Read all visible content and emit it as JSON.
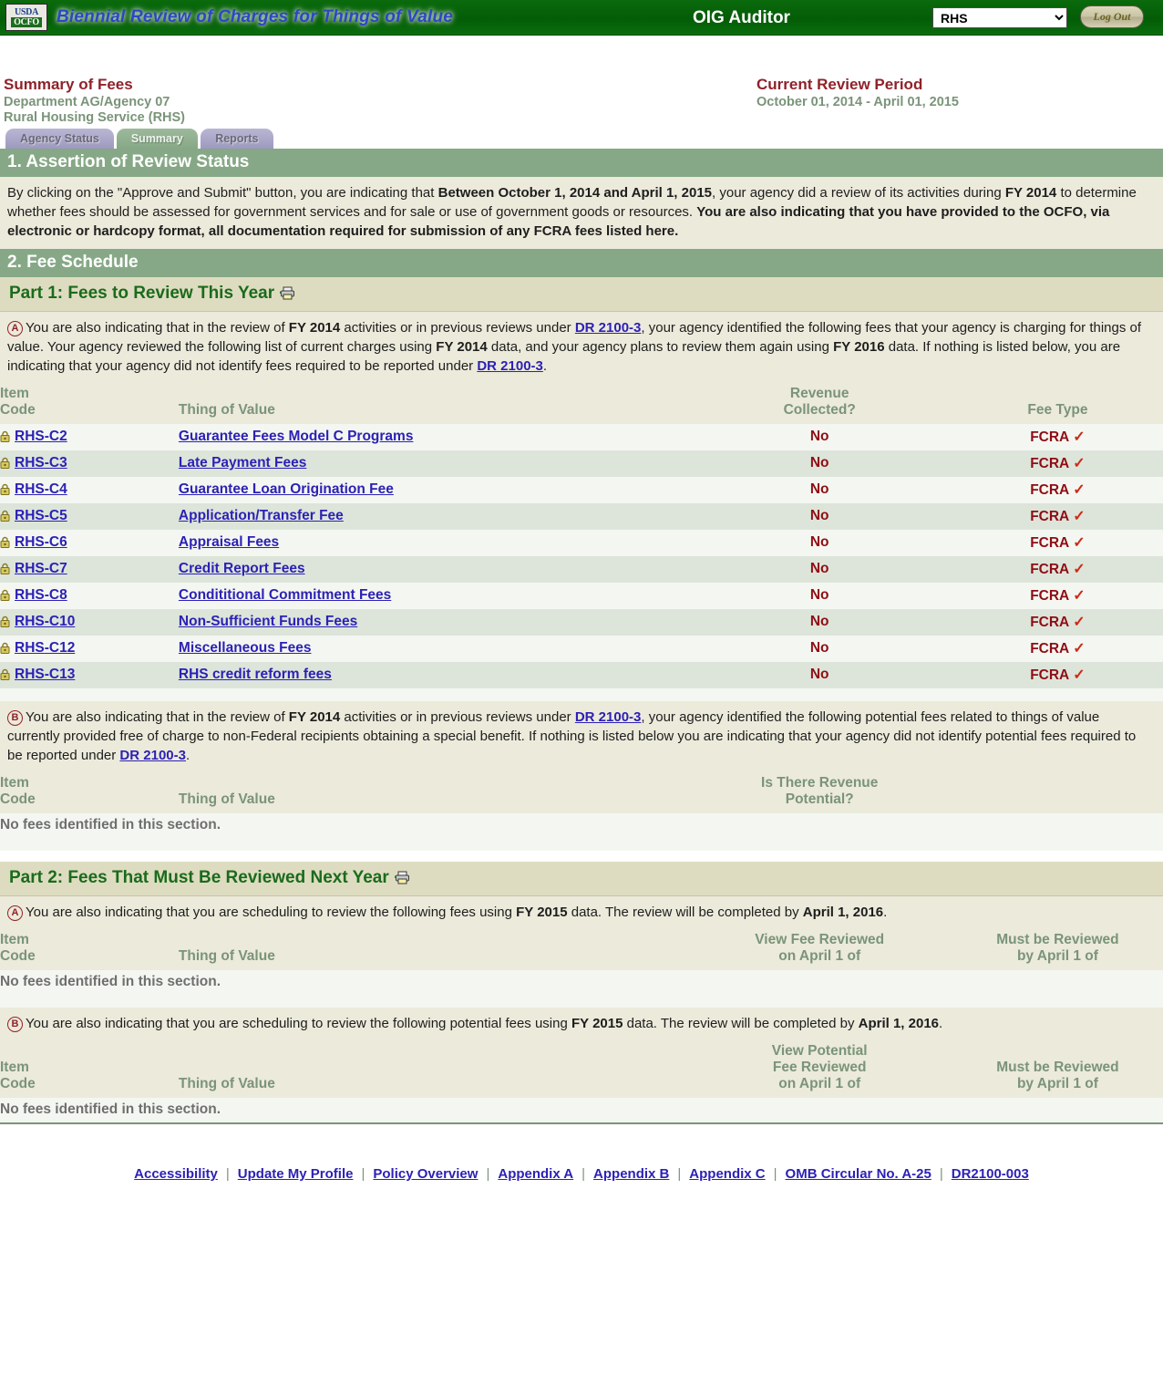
{
  "header": {
    "logo_line1": "USDA",
    "logo_line2": "OCFO",
    "app_title": "Biennial Review of Charges for Things of Value",
    "role": "OIG Auditor",
    "agency_selected": "RHS",
    "agency_options": [
      "RHS"
    ],
    "logout_label": "Log Out"
  },
  "page": {
    "summary_title": "Summary of Fees",
    "department": "Department AG/Agency 07",
    "agency_name": "Rural Housing Service (RHS)",
    "review_period_title": "Current Review Period",
    "review_period_dates": "October 01, 2014 - April 01, 2015"
  },
  "tabs": [
    {
      "label": "Agency Status",
      "active": false
    },
    {
      "label": "Summary",
      "active": true
    },
    {
      "label": "Reports",
      "active": false
    }
  ],
  "section1": {
    "banner": "1. Assertion of Review Status",
    "text_1": "By clicking on the \"Approve and Submit\" button, you are indicating that ",
    "bold_1": "Between October 1, 2014 and April 1, 2015",
    "text_2": ", your agency did a review of its activities during ",
    "bold_2": "FY 2014",
    "text_3": " to determine whether fees should be assessed for government services and for sale or use of government goods or resources. ",
    "bold_3": "You are also indicating that you have provided to the OCFO, via electronic or hardcopy format, all documentation required for submission of any FCRA fees listed here."
  },
  "section2": {
    "banner": "2. Fee Schedule"
  },
  "part1": {
    "title": "Part 1: Fees to Review This Year",
    "print_icon": "printer-icon",
    "a": {
      "marker": "A",
      "t1": "You are also indicating that in the review of ",
      "b1": "FY 2014",
      "t2": " activities or in previous reviews under ",
      "link1": "DR 2100-3",
      "t3": ", your agency identified the following fees that your agency is charging for things of value. Your agency reviewed the following list of current charges using ",
      "b2": "FY 2014",
      "t4": " data, and your agency plans to review them again using ",
      "b3": "FY 2016",
      "t5": " data. If nothing is listed below, you are indicating that your agency did not identify fees required to be reported under ",
      "link2": "DR 2100-3",
      "t6": ".",
      "columns": {
        "code_l1": "Item",
        "code_l2": "Code",
        "thing": "Thing of Value",
        "rev_l1": "Revenue",
        "rev_l2": "Collected?",
        "type": "Fee Type"
      },
      "rows": [
        {
          "icon": "lock-icon",
          "code": "RHS-C2",
          "thing": "Guarantee Fees Model C Programs",
          "revenue": "No",
          "fee_type": "FCRA",
          "check": "✓"
        },
        {
          "icon": "lock-icon",
          "code": "RHS-C3",
          "thing": "Late Payment Fees",
          "revenue": "No",
          "fee_type": "FCRA",
          "check": "✓"
        },
        {
          "icon": "lock-icon",
          "code": "RHS-C4",
          "thing": "Guarantee Loan Origination Fee",
          "revenue": "No",
          "fee_type": "FCRA",
          "check": "✓"
        },
        {
          "icon": "lock-icon",
          "code": "RHS-C5",
          "thing": "Application/Transfer Fee",
          "revenue": "No",
          "fee_type": "FCRA",
          "check": "✓"
        },
        {
          "icon": "lock-icon",
          "code": "RHS-C6",
          "thing": "Appraisal Fees",
          "revenue": "No",
          "fee_type": "FCRA",
          "check": "✓"
        },
        {
          "icon": "lock-icon",
          "code": "RHS-C7",
          "thing": "Credit Report Fees",
          "revenue": "No",
          "fee_type": "FCRA",
          "check": "✓"
        },
        {
          "icon": "lock-icon",
          "code": "RHS-C8",
          "thing": "Condititional Commitment Fees",
          "revenue": "No",
          "fee_type": "FCRA",
          "check": "✓"
        },
        {
          "icon": "lock-icon",
          "code": "RHS-C10",
          "thing": "Non-Sufficient Funds Fees",
          "revenue": "No",
          "fee_type": "FCRA",
          "check": "✓"
        },
        {
          "icon": "lock-icon",
          "code": "RHS-C12",
          "thing": "Miscellaneous Fees",
          "revenue": "No",
          "fee_type": "FCRA",
          "check": "✓"
        },
        {
          "icon": "lock-icon",
          "code": "RHS-C13",
          "thing": "RHS credit reform fees",
          "revenue": "No",
          "fee_type": "FCRA",
          "check": "✓"
        }
      ]
    },
    "b": {
      "marker": "B",
      "t1": "You are also indicating that in the review of ",
      "b1": "FY 2014",
      "t2": " activities or in previous reviews under ",
      "link1": "DR 2100-3",
      "t3": ", your agency identified the following potential fees related to things of value currently provided free of charge to non-Federal recipients obtaining a special benefit. If nothing is listed below you are indicating that your agency did not identify potential fees required to be reported under ",
      "link2": "DR 2100-3",
      "t4": ".",
      "columns": {
        "code_l1": "Item",
        "code_l2": "Code",
        "thing": "Thing of Value",
        "pot_l1": "Is There Revenue",
        "pot_l2": "Potential?"
      },
      "empty_message": "No fees identified in this section."
    }
  },
  "part2": {
    "title": "Part 2: Fees That Must Be Reviewed Next Year",
    "print_icon": "printer-icon",
    "a": {
      "marker": "A",
      "t1": "You are also indicating that you are scheduling to review the following fees using ",
      "b1": "FY 2015",
      "t2": " data. The review will be completed by ",
      "b2": "April 1, 2016",
      "t3": ".",
      "columns": {
        "code_l1": "Item",
        "code_l2": "Code",
        "thing": "Thing of Value",
        "view_l1": "View Fee Reviewed",
        "view_l2": "on April 1 of",
        "must_l1": "Must be Reviewed",
        "must_l2": "by April 1 of"
      },
      "empty_message": "No fees identified in this section."
    },
    "b": {
      "marker": "B",
      "t1": "You are also indicating that you are scheduling to review the following potential fees using ",
      "b1": "FY 2015",
      "t2": " data. The review will be completed by ",
      "b2": "April 1, 2016",
      "t3": ".",
      "columns": {
        "code_l1": "Item",
        "code_l2": "Code",
        "thing": "Thing of Value",
        "view_l1": "View Potential",
        "view_l2": "Fee Reviewed",
        "view_l3": "on April 1 of",
        "must_l1": "Must be Reviewed",
        "must_l2": "by April 1 of"
      },
      "empty_message": "No fees identified in this section."
    }
  },
  "footer": {
    "links": [
      "Accessibility",
      "Update My Profile",
      "Policy Overview",
      "Appendix A",
      "Appendix B",
      "Appendix C",
      "OMB Circular No. A-25",
      "DR2100-003"
    ],
    "separator": "|"
  },
  "colors": {
    "header_green": "#056109",
    "banner_green": "#86a886",
    "part_bar": "#dedcc0",
    "prose_bg": "#eceadb",
    "row_odd": "#f4f7f1",
    "row_even": "#dde5da",
    "link_blue": "#2c21b5",
    "title_maroon": "#8f2229",
    "label_green": "#7a9479",
    "data_red": "#8f0d15",
    "check_red": "#cc2b18"
  }
}
